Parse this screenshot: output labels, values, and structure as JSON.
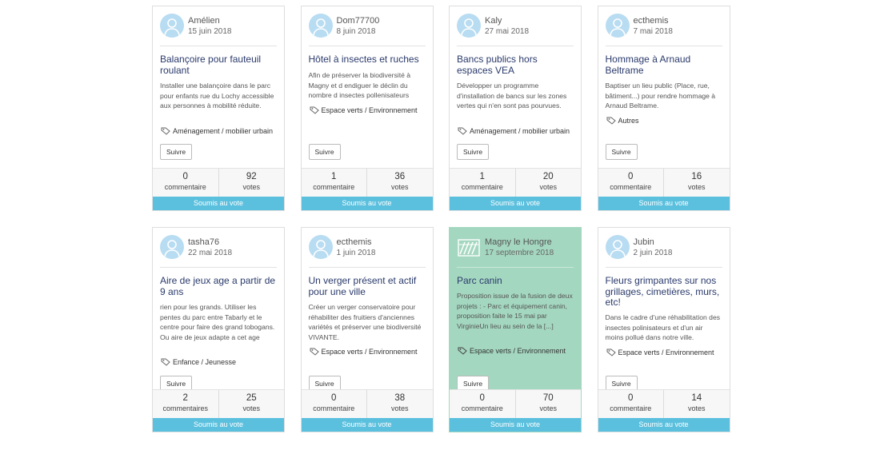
{
  "follow_label": "Suivre",
  "status_label": "Soumis au vote",
  "colors": {
    "status_bar": "#5bc0de",
    "highlight_card": "#a4d7c0",
    "title": "#2a3a6b"
  },
  "cards": [
    {
      "author": "Amélien",
      "date": "15 juin 2018",
      "title": "Balançoire pour fauteuil roulant",
      "description": "Installer une balançoire dans le parc pour enfants rue du Lochy accessible aux personnes à mobilité réduite.",
      "tag": "Aménagement / mobilier urbain",
      "comments": "0",
      "comments_label": "commentaire",
      "votes": "92",
      "votes_label": "votes"
    },
    {
      "author": "Dom77700",
      "date": "8 juin 2018",
      "title": "Hôtel à insectes et ruches",
      "description": "Afin de préserver la biodiversité à Magny et d endiguer le déclin du nombre d insectes pollenisateurs",
      "tag": "Espace verts / Environnement",
      "comments": "1",
      "comments_label": "commentaire",
      "votes": "36",
      "votes_label": "votes"
    },
    {
      "author": "Kaly",
      "date": "27 mai 2018",
      "title": "Bancs publics hors espaces VEA",
      "description": "Développer un programme d'installation de bancs sur les zones vertes qui n'en sont pas pourvues.",
      "tag": "Aménagement / mobilier urbain",
      "comments": "1",
      "comments_label": "commentaire",
      "votes": "20",
      "votes_label": "votes"
    },
    {
      "author": "ecthemis",
      "date": "7 mai 2018",
      "title": "Hommage à Arnaud Beltrame",
      "description": "Baptiser un lieu public (Place, rue, bâtiment...) pour rendre hommage à Arnaud Beltrame.",
      "tag": "Autres",
      "comments": "0",
      "comments_label": "commentaire",
      "votes": "16",
      "votes_label": "votes"
    },
    {
      "author": "tasha76",
      "date": "22 mai 2018",
      "title": "Aire de jeux age a partir de 9 ans",
      "description": "rien pour les grands. Utiliser les pentes du parc entre Tabarly et le centre pour faire des grand tobogans. Ou aire de jeux adapte a cet age",
      "tag": "Enfance / Jeunesse",
      "comments": "2",
      "comments_label": "commentaires",
      "votes": "25",
      "votes_label": "votes"
    },
    {
      "author": "ecthemis",
      "date": "1 juin 2018",
      "title": "Un verger présent et actif pour une ville",
      "description": "Créer un verger conservatoire pour réhabiliter des fruitiers d'anciennes variétés et préserver une biodiversité VIVANTE.",
      "tag": "Espace verts / Environnement",
      "comments": "0",
      "comments_label": "commentaire",
      "votes": "38",
      "votes_label": "votes"
    },
    {
      "author": "Magny le Hongre",
      "date": "17 septembre 2018",
      "title": "Parc canin",
      "description": "Proposition issue de la fusion de deux projets : - Parc et équipement canin, proposition faite le 15 mai par VirginieUn lieu au sein de la [...]",
      "tag": "Espace verts / Environnement",
      "comments": "0",
      "comments_label": "commentaire",
      "votes": "70",
      "votes_label": "votes"
    },
    {
      "author": "Jubin",
      "date": "2 juin 2018",
      "title": "Fleurs grimpantes sur nos grillages, cimetières, murs, etc!",
      "description": "Dans le cadre d'une réhabilitation des insectes polinisateurs et d'un air moins pollué dans notre ville.",
      "tag": "Espace verts / Environnement",
      "comments": "0",
      "comments_label": "commentaire",
      "votes": "14",
      "votes_label": "votes"
    }
  ]
}
